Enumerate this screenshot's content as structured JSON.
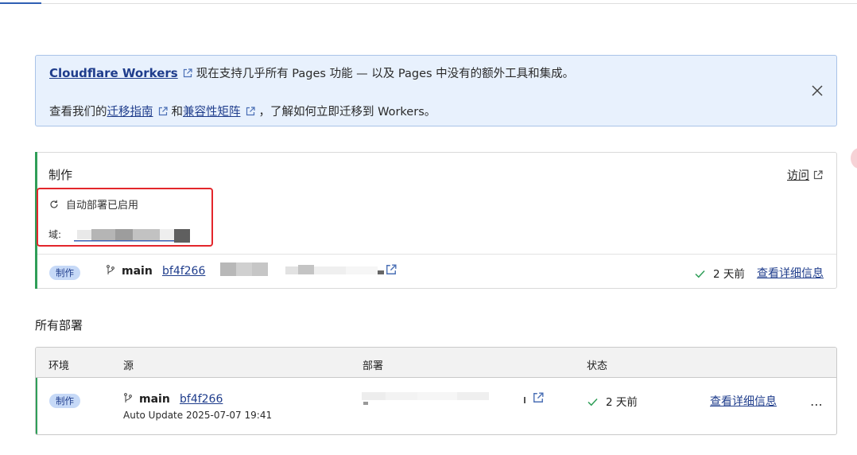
{
  "notice": {
    "brand_link": "Cloudflare Workers",
    "line1_text": "现在支持几乎所有 Pages 功能 — 以及 Pages 中没有的额外工具和集成。",
    "line2_prefix": "查看我们的",
    "migration_link": "迁移指南",
    "and_text": "和",
    "compat_link": "兼容性矩阵",
    "line2_suffix": "，了解如何立即迁移到 Workers。"
  },
  "production": {
    "title": "制作",
    "visit_label": "访问",
    "autodeploy_label": "自动部署已启用",
    "domain_label": "域:",
    "badge": "制作",
    "branch": "main",
    "commit": "bf4f266",
    "status": "2 天前",
    "details_label": "查看详细信息"
  },
  "all_deployments": {
    "title": "所有部署",
    "columns": [
      "环境",
      "源",
      "部署",
      "状态"
    ],
    "rows": [
      {
        "badge": "制作",
        "branch": "main",
        "commit": "bf4f266",
        "auto_update": "Auto Update 2025-07-07 19:41",
        "status": "2 天前",
        "details_label": "查看详细信息",
        "more": "⋯"
      }
    ]
  },
  "colors": {
    "accent_link": "#1f3d8c",
    "success": "#2f9e58",
    "notice_bg": "#e8f1fd",
    "highlight": "#e3262b"
  },
  "icons": [
    "external-link-icon",
    "close-icon",
    "refresh-icon",
    "git-branch-icon",
    "check-icon",
    "more-icon"
  ]
}
